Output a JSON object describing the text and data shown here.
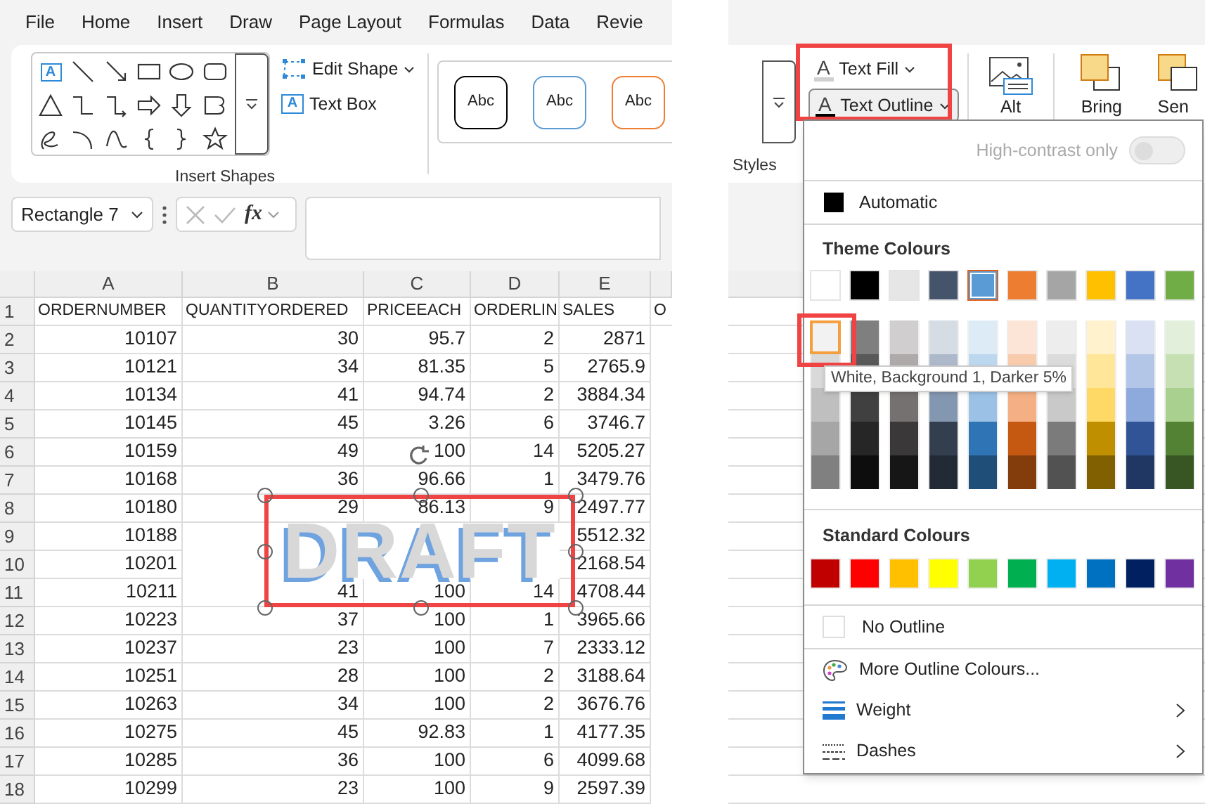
{
  "menu_tabs": [
    {
      "label": "File"
    },
    {
      "label": "Home"
    },
    {
      "label": "Insert"
    },
    {
      "label": "Draw"
    },
    {
      "label": "Page Layout"
    },
    {
      "label": "Formulas"
    },
    {
      "label": "Data"
    },
    {
      "label": "Revie"
    }
  ],
  "ribbon": {
    "text_box_tool_glyph": "A",
    "edit_shape": "Edit Shape",
    "text_box": {
      "glyph": "A",
      "label": "Text Box"
    },
    "shapes_group": "Insert Shapes",
    "shape_styles": [
      {
        "label": "Abc",
        "color": "#000000"
      },
      {
        "label": "Abc",
        "color": "#5b9bd5"
      },
      {
        "label": "Abc",
        "color": "#ed7d31"
      }
    ],
    "styles_group": "Styles",
    "text_fill": {
      "glyph": "A",
      "label": "Text Fill"
    },
    "text_outline": {
      "glyph": "A",
      "label": "Text Outline",
      "expanded": true
    },
    "alt_text": "Alt",
    "bring_forward": "Bring",
    "send_backward": "Sen"
  },
  "formula_bar": {
    "name_box": "Rectangle 7",
    "function_label": "fx"
  },
  "sheet": {
    "columns": [
      "A",
      "B",
      "C",
      "D",
      "E"
    ],
    "rows": [
      {
        "number": "1",
        "cells": [
          "ORDERNUMBER",
          "QUANTITYORDERED",
          "PRICEEACH",
          "ORDERLIN",
          "SALES",
          "O"
        ]
      },
      {
        "number": "2",
        "cells": [
          "10107",
          "30",
          "95.7",
          "2",
          "2871"
        ]
      },
      {
        "number": "3",
        "cells": [
          "10121",
          "34",
          "81.35",
          "5",
          "2765.9"
        ]
      },
      {
        "number": "4",
        "cells": [
          "10134",
          "41",
          "94.74",
          "2",
          "3884.34"
        ]
      },
      {
        "number": "5",
        "cells": [
          "10145",
          "45",
          "3.26",
          "6",
          "3746.7"
        ]
      },
      {
        "number": "6",
        "cells": [
          "10159",
          "49",
          "100",
          "14",
          "5205.27"
        ]
      },
      {
        "number": "7",
        "cells": [
          "10168",
          "36",
          "96.66",
          "1",
          "3479.76"
        ]
      },
      {
        "number": "8",
        "cells": [
          "10180",
          "29",
          "86.13",
          "9",
          "2497.77"
        ]
      },
      {
        "number": "9",
        "cells": [
          "10188",
          null,
          null,
          null,
          "5512.32"
        ]
      },
      {
        "number": "10",
        "cells": [
          "10201",
          null,
          null,
          null,
          "2168.54"
        ]
      },
      {
        "number": "11",
        "cells": [
          "10211",
          "41",
          "100",
          "14",
          "4708.44"
        ]
      },
      {
        "number": "12",
        "cells": [
          "10223",
          "37",
          "100",
          "1",
          "3965.66"
        ]
      },
      {
        "number": "13",
        "cells": [
          "10237",
          "23",
          "100",
          "7",
          "2333.12"
        ]
      },
      {
        "number": "14",
        "cells": [
          "10251",
          "28",
          "100",
          "2",
          "3188.64"
        ]
      },
      {
        "number": "15",
        "cells": [
          "10263",
          "34",
          "100",
          "2",
          "3676.76"
        ]
      },
      {
        "number": "16",
        "cells": [
          "10275",
          "45",
          "92.83",
          "1",
          "4177.35"
        ]
      },
      {
        "number": "17",
        "cells": [
          "10285",
          "36",
          "100",
          "6",
          "4099.68"
        ]
      },
      {
        "number": "18",
        "cells": [
          "10299",
          "23",
          "100",
          "9",
          "2597.39"
        ]
      }
    ]
  },
  "text_box_shape": {
    "text": "DRAFT",
    "selected": true
  },
  "outline_menu": {
    "high_contrast": {
      "label": "High-contrast only",
      "on": false,
      "disabled": true
    },
    "automatic": {
      "label": "Automatic",
      "color": "#000000"
    },
    "theme_heading": "Theme Colours",
    "theme_colours": [
      {
        "color": "#ffffff",
        "selected": false,
        "shades": [
          {
            "color": "#f2f2f2",
            "hovered": true
          },
          {
            "color": "#d9d9d9",
            "hovered": false
          },
          {
            "color": "#bfbfbf",
            "hovered": false
          },
          {
            "color": "#a6a6a6",
            "hovered": false
          },
          {
            "color": "#808080",
            "hovered": false
          }
        ]
      },
      {
        "color": "#000000",
        "selected": false,
        "shades": [
          {
            "color": "#7f7f7f",
            "hovered": false
          },
          {
            "color": "#595959",
            "hovered": false
          },
          {
            "color": "#404040",
            "hovered": false
          },
          {
            "color": "#262626",
            "hovered": false
          },
          {
            "color": "#0d0d0d",
            "hovered": false
          }
        ]
      },
      {
        "color": "#e7e6e6",
        "selected": false,
        "shades": [
          {
            "color": "#d0cece",
            "hovered": false
          },
          {
            "color": "#aeaaaa",
            "hovered": false
          },
          {
            "color": "#757171",
            "hovered": false
          },
          {
            "color": "#3a3838",
            "hovered": false
          },
          {
            "color": "#161616",
            "hovered": false
          }
        ]
      },
      {
        "color": "#44546a",
        "selected": false,
        "shades": [
          {
            "color": "#d6dce4",
            "hovered": false
          },
          {
            "color": "#adb9ca",
            "hovered": false
          },
          {
            "color": "#8497b0",
            "hovered": false
          },
          {
            "color": "#333f4f",
            "hovered": false
          },
          {
            "color": "#222b35",
            "hovered": false
          }
        ]
      },
      {
        "color": "#5b9bd5",
        "selected": true,
        "shades": [
          {
            "color": "#ddebf7",
            "hovered": false
          },
          {
            "color": "#bdd7ee",
            "hovered": false
          },
          {
            "color": "#9bc2e6",
            "hovered": false
          },
          {
            "color": "#2f75b5",
            "hovered": false
          },
          {
            "color": "#1f4e78",
            "hovered": false
          }
        ]
      },
      {
        "color": "#ed7d31",
        "selected": false,
        "shades": [
          {
            "color": "#fce4d6",
            "hovered": false
          },
          {
            "color": "#f8cbad",
            "hovered": false
          },
          {
            "color": "#f4b084",
            "hovered": false
          },
          {
            "color": "#c65911",
            "hovered": false
          },
          {
            "color": "#833c0c",
            "hovered": false
          }
        ]
      },
      {
        "color": "#a5a5a5",
        "selected": false,
        "shades": [
          {
            "color": "#ededed",
            "hovered": false
          },
          {
            "color": "#dbdbdb",
            "hovered": false
          },
          {
            "color": "#c9c9c9",
            "hovered": false
          },
          {
            "color": "#7b7b7b",
            "hovered": false
          },
          {
            "color": "#525252",
            "hovered": false
          }
        ]
      },
      {
        "color": "#ffc000",
        "selected": false,
        "shades": [
          {
            "color": "#fff2cc",
            "hovered": false
          },
          {
            "color": "#ffe699",
            "hovered": false
          },
          {
            "color": "#ffd966",
            "hovered": false
          },
          {
            "color": "#bf8f00",
            "hovered": false
          },
          {
            "color": "#806000",
            "hovered": false
          }
        ]
      },
      {
        "color": "#4472c4",
        "selected": false,
        "shades": [
          {
            "color": "#d9e1f2",
            "hovered": false
          },
          {
            "color": "#b4c6e7",
            "hovered": false
          },
          {
            "color": "#8ea9db",
            "hovered": false
          },
          {
            "color": "#305496",
            "hovered": false
          },
          {
            "color": "#203764",
            "hovered": false
          }
        ]
      },
      {
        "color": "#70ad47",
        "selected": false,
        "shades": [
          {
            "color": "#e2efda",
            "hovered": false
          },
          {
            "color": "#c6e0b4",
            "hovered": false
          },
          {
            "color": "#a9d08e",
            "hovered": false
          },
          {
            "color": "#548235",
            "hovered": false
          },
          {
            "color": "#375623",
            "hovered": false
          }
        ]
      }
    ],
    "tooltip": "White, Background 1, Darker 5%",
    "standard_heading": "Standard Colours",
    "standard_colours": [
      {
        "color": "#c00000"
      },
      {
        "color": "#ff0000"
      },
      {
        "color": "#ffc000"
      },
      {
        "color": "#ffff00"
      },
      {
        "color": "#92d050"
      },
      {
        "color": "#00b050"
      },
      {
        "color": "#00b0f0"
      },
      {
        "color": "#0070c0"
      },
      {
        "color": "#002060"
      },
      {
        "color": "#7030a0"
      }
    ],
    "items": [
      {
        "kind": "no_outline",
        "label": "No Outline",
        "submenu": false
      },
      {
        "kind": "more_colours",
        "label": "More Outline Colours...",
        "submenu": false
      },
      {
        "kind": "weight",
        "label": "Weight",
        "submenu": true
      },
      {
        "kind": "dashes",
        "label": "Dashes",
        "submenu": true
      }
    ]
  }
}
